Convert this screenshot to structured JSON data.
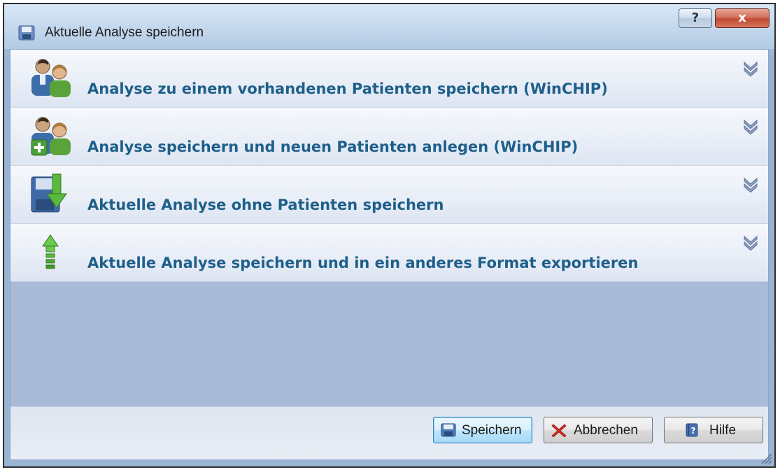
{
  "window": {
    "title": "Aktuelle Analyse speichern",
    "help_label": "?",
    "close_label": "x"
  },
  "panels": [
    {
      "label": "Analyse zu einem vorhandenen Patienten speichern (WinCHIP)",
      "icon": "users-icon"
    },
    {
      "label": "Analyse speichern und neuen Patienten anlegen (WinCHIP)",
      "icon": "add-user-icon"
    },
    {
      "label": "Aktuelle Analyse ohne Patienten speichern",
      "icon": "save-down-icon"
    },
    {
      "label": "Aktuelle Analyse speichern und in ein anderes Format exportieren",
      "icon": "export-up-icon"
    }
  ],
  "buttons": {
    "save": "Speichern",
    "cancel": "Abbrechen",
    "help": "Hilfe"
  },
  "colors": {
    "accent_text": "#1e5f8a",
    "body_bg": "#aabbd8"
  }
}
